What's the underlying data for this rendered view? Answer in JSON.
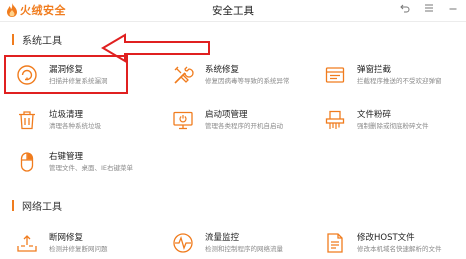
{
  "app": {
    "logo_text": "火绒安全",
    "window_title": "安全工具",
    "brand_color": "#f07c1e",
    "controls": [
      "back-icon",
      "menu-icon",
      "minimize-icon"
    ]
  },
  "sections": [
    {
      "title": "系统工具",
      "tools": [
        {
          "name": "漏洞修复",
          "desc": "扫描并修复系统漏洞",
          "icon": "vulnerability-repair-icon"
        },
        {
          "name": "系统修复",
          "desc": "修复因病毒等导致的系统异常",
          "icon": "system-repair-icon"
        },
        {
          "name": "弹窗拦截",
          "desc": "拦截程序推送的不受欢迎弹窗",
          "icon": "popup-block-icon"
        },
        {
          "name": "垃圾清理",
          "desc": "清理各种系统垃圾",
          "icon": "trash-clean-icon"
        },
        {
          "name": "启动项管理",
          "desc": "管理各类程序的开机自启动",
          "icon": "startup-manager-icon"
        },
        {
          "name": "文件粉碎",
          "desc": "强制删除或彻底粉碎文件",
          "icon": "file-shredder-icon"
        },
        {
          "name": "右键管理",
          "desc": "管理文件、桌面、IE右键菜单",
          "icon": "right-click-manager-icon"
        }
      ]
    },
    {
      "title": "网络工具",
      "tools": [
        {
          "name": "断网修复",
          "desc": "检测并修复断网问题",
          "icon": "network-repair-icon"
        },
        {
          "name": "流量监控",
          "desc": "检测和控制程序的网络流量",
          "icon": "traffic-monitor-icon"
        },
        {
          "name": "修改HOST文件",
          "desc": "修改本机域名快速解析的文件",
          "icon": "host-file-icon"
        }
      ]
    }
  ],
  "annotation": {
    "highlight_color": "#e02020",
    "highlighted_tool": "漏洞修复"
  }
}
